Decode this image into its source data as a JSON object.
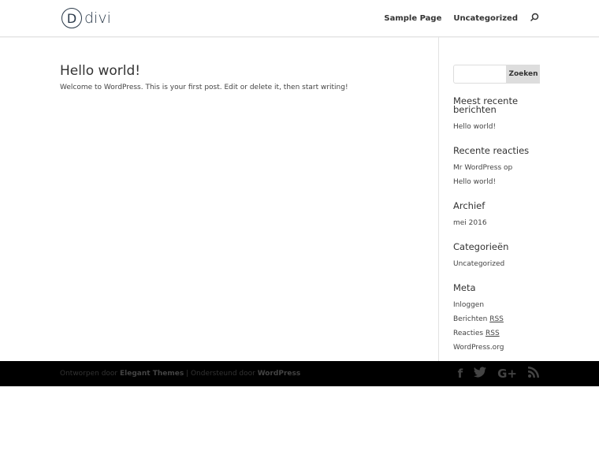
{
  "logo": {
    "letter": "D",
    "text": "divi"
  },
  "nav": {
    "items": [
      "Sample Page",
      "Uncategorized"
    ]
  },
  "post": {
    "title": "Hello world!",
    "excerpt": "Welcome to WordPress. This is your first post. Edit or delete it, then start writing!"
  },
  "sidebar": {
    "search": {
      "placeholder": "",
      "button": "Zoeken"
    },
    "widgets": [
      {
        "title": "Meest recente berichten",
        "items": [
          "Hello world!"
        ]
      },
      {
        "title": "Recente reacties",
        "items": [
          "Mr WordPress op Hello world!"
        ]
      },
      {
        "title": "Archief",
        "items": [
          "mei 2016"
        ]
      },
      {
        "title": "Categorieën",
        "items": [
          "Uncategorized"
        ]
      },
      {
        "title": "Meta",
        "items": [
          "Inloggen",
          "Berichten",
          "Reacties",
          "WordPress.org"
        ],
        "abbr": "RSS"
      }
    ]
  },
  "footer": {
    "prefix": "Ontworpen door ",
    "link1": "Elegant Themes",
    "middle": " | Ondersteund door ",
    "link2": "WordPress",
    "social": [
      "f",
      "t",
      "G+",
      "rss"
    ]
  }
}
